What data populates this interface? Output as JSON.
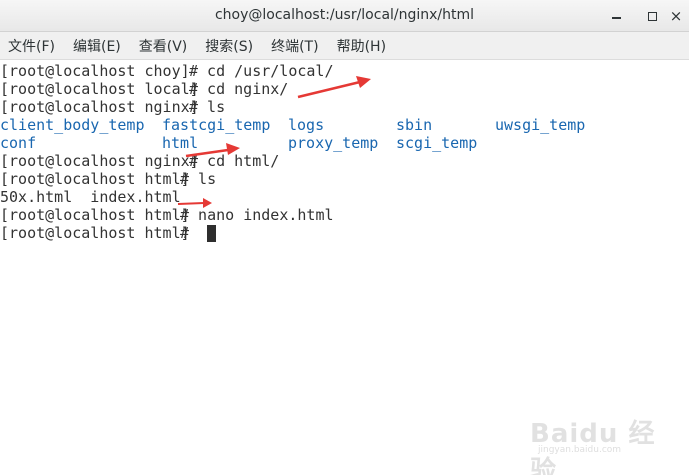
{
  "window": {
    "title": "choy@localhost:/usr/local/nginx/html",
    "minimize_icon": "minimize-icon",
    "maximize_icon": "maximize-icon",
    "close_icon": "close-icon",
    "close_glyph": "×"
  },
  "menu": {
    "items": [
      {
        "label": "文件(F)"
      },
      {
        "label": "编辑(E)"
      },
      {
        "label": "查看(V)"
      },
      {
        "label": "搜索(S)"
      },
      {
        "label": "终端(T)"
      },
      {
        "label": "帮助(H)"
      }
    ]
  },
  "terminal": {
    "lines": [
      {
        "prompt": "[root@localhost choy]",
        "command": "# cd /usr/local/"
      },
      {
        "prompt": "[root@localhost local]",
        "command": "# cd nginx/"
      },
      {
        "prompt": "[root@localhost nginx]",
        "command": "# ls"
      },
      {
        "listing": [
          "client_body_temp",
          "fastcgi_temp",
          "logs",
          "sbin",
          "uwsgi_temp"
        ]
      },
      {
        "listing": [
          "conf",
          "html",
          "proxy_temp",
          "scgi_temp"
        ]
      },
      {
        "prompt": "[root@localhost nginx]",
        "command": "# cd html/"
      },
      {
        "prompt": "[root@localhost html]",
        "command": "# ls"
      },
      {
        "output": "50x.html  index.html"
      },
      {
        "prompt": "[root@localhost html]",
        "command": "# nano index.html"
      },
      {
        "prompt": "[root@localhost html]",
        "command": "# "
      }
    ],
    "text_color": "#333333",
    "dir_color": "#1a67b0",
    "cursor_color": "#2e2e2e"
  },
  "annotations": {
    "arrow_color": "#e53935"
  },
  "watermark": {
    "logo_text": "Baidu 经验",
    "url": "jingyan.baidu.com"
  }
}
